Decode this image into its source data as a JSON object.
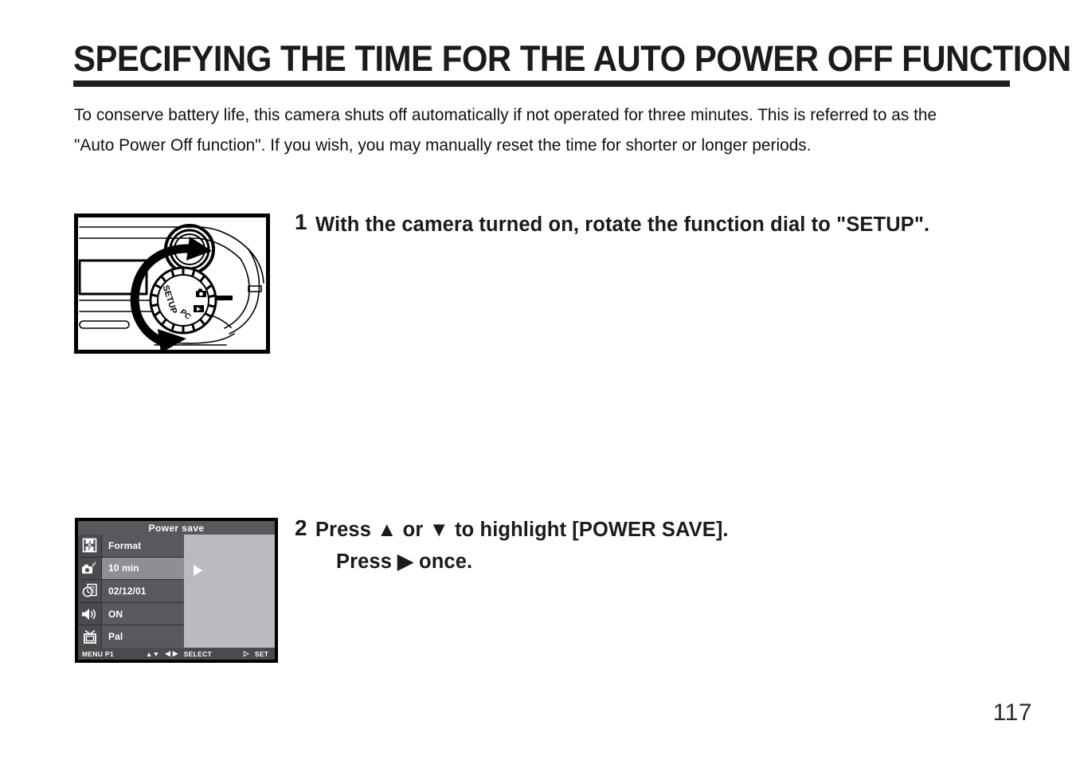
{
  "document": {
    "title": "SPECIFYING THE TIME FOR THE AUTO POWER OFF FUNCTION",
    "intro": "To conserve battery life, this camera shuts off automatically if not operated for three minutes. This is referred to as the \"Auto Power Off function\". If you wish, you may manually reset the time for shorter or longer periods.",
    "page_number": "117"
  },
  "steps": [
    {
      "number": "1",
      "text": "With the camera turned on, rotate the function dial to \"SETUP\".",
      "line2": ""
    },
    {
      "number": "2",
      "text": "Press ▲ or ▼ to highlight [POWER SAVE].",
      "line2": "Press ▶ once."
    }
  ],
  "dial_figure": {
    "caption": "",
    "dial_labels": {
      "setup": "SETUP",
      "pc": "PC"
    }
  },
  "lcd": {
    "title": "Power save",
    "rows": [
      {
        "icon": "format-card-icon",
        "value": "Format",
        "selected": false
      },
      {
        "icon": "power-save-icon",
        "value": "10 min",
        "selected": true
      },
      {
        "icon": "date-time-icon",
        "value": "02/12/01",
        "selected": false
      },
      {
        "icon": "speaker-sound-icon",
        "value": "ON",
        "selected": false
      },
      {
        "icon": "tv-output-icon",
        "value": "Pal",
        "selected": false
      }
    ],
    "panel_arrow": "right-triangle-icon",
    "statusbar": {
      "menu": "MENU P1",
      "updown": "▲▼",
      "leftright": "◀ ▶",
      "select": "SELECT",
      "set_arrow": "▷",
      "set": "SET"
    }
  },
  "colors": {
    "rule": "#231f20",
    "lcd_bg": "#58595c",
    "lcd_selected": "#8d8f93",
    "lcd_icon_bg": "#4a4b4e",
    "lcd_panel": "#b9bbbe",
    "text": "#111111"
  }
}
